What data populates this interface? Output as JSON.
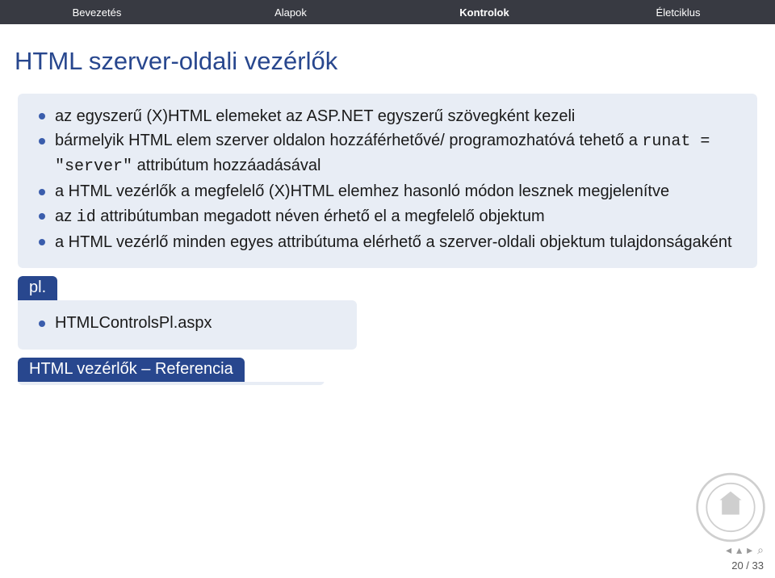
{
  "nav": {
    "items": [
      {
        "label": "Bevezetés"
      },
      {
        "label": "Alapok"
      },
      {
        "label": "Kontrolok"
      },
      {
        "label": "Életciklus"
      }
    ]
  },
  "title": "HTML szerver-oldali vezérlők",
  "main_block": {
    "items": [
      "az egyszerű (X)HTML elemeket az ASP.NET egyszerű szövegként kezeli",
      {
        "pre": "bármelyik HTML elem szerver oldalon hozzáférhetővé/ programozhatóvá tehető a ",
        "code": "runat = \"server\"",
        "post": " attribútum hozzáadásával"
      },
      "a HTML vezérlők a megfelelő (X)HTML elemhez hasonló módon lesznek megjelenítve",
      {
        "pre": "az ",
        "code": "id",
        "post": " attribútumban megadott néven érhető el a megfelelő objektum"
      },
      "a HTML vezérlő minden egyes attribútuma elérhető a szerver-oldali objektum tulajdonságaként"
    ]
  },
  "example_block": {
    "head": "pl.",
    "item": "HTMLControlsPl.aspx"
  },
  "ref_block": {
    "head": "HTML vezérlők – Referencia"
  },
  "page_counter": "20 / 33"
}
